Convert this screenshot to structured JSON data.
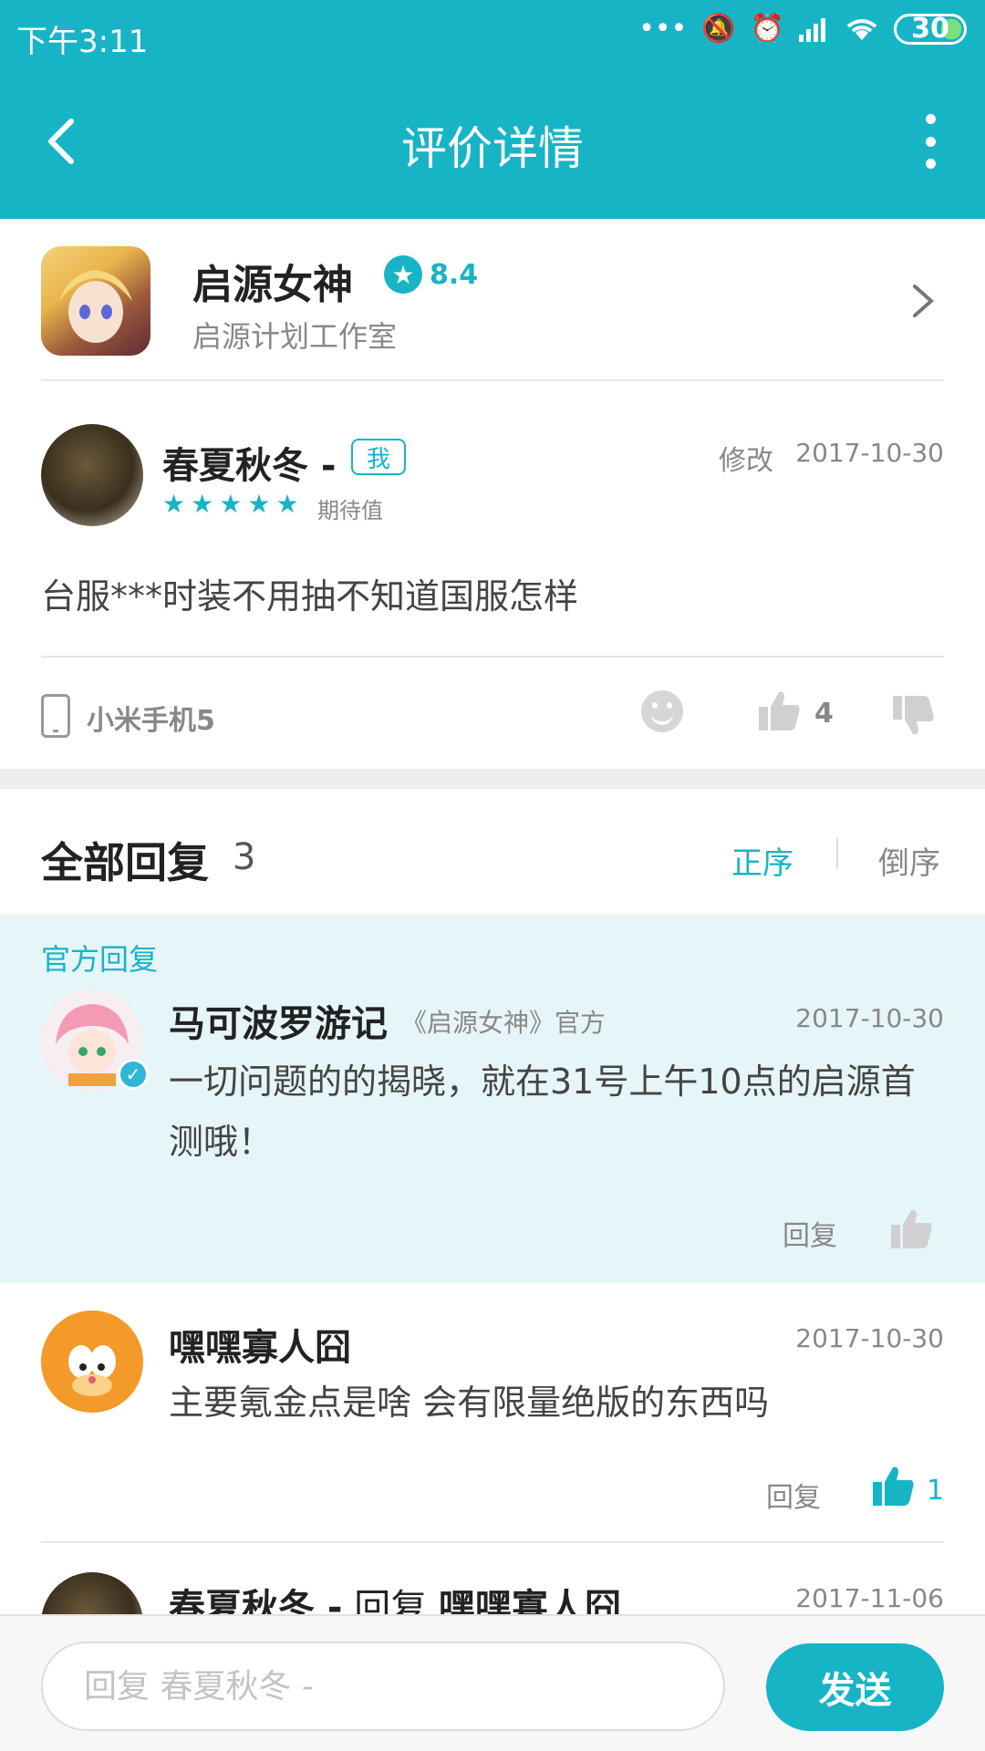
{
  "status_bar": {
    "time": "下午3:11",
    "battery": "30"
  },
  "app_bar": {
    "title": "评价详情"
  },
  "game": {
    "name": "启源女神",
    "score": "8.4",
    "studio": "启源计划工作室"
  },
  "review": {
    "author": "春夏秋冬 -",
    "me_badge": "我",
    "stars": 5,
    "expect_label": "期待值",
    "edit_label": "修改",
    "date": "2017-10-30",
    "text": "台服***时装不用抽不知道国服怎样",
    "device": "小米手机5",
    "like_count": "4"
  },
  "replies": {
    "title": "全部回复",
    "count": "3",
    "sort_asc": "正序",
    "sort_desc": "倒序",
    "reply_label": "回复",
    "official": {
      "label": "官方回复",
      "name": "马可波罗游记",
      "tag": "《启源女神》官方",
      "date": "2017-10-30",
      "text": "一切问题的的揭晓，就在31号上午10点的启源首测哦！"
    },
    "items": [
      {
        "name": "嘿嘿寡人囧",
        "date": "2017-10-30",
        "text": "主要氪金点是啥 会有限量绝版的东西吗",
        "like_count": "1"
      },
      {
        "name": "春夏秋冬 -",
        "reply_word": "回复",
        "target": "嘿嘿寡人囧",
        "date": "2017-11-06"
      }
    ]
  },
  "input_bar": {
    "placeholder": "回复 春夏秋冬 -",
    "send_label": "发送"
  },
  "colors": {
    "accent": "#17b4c6",
    "official_bg": "#e6f6f8"
  }
}
